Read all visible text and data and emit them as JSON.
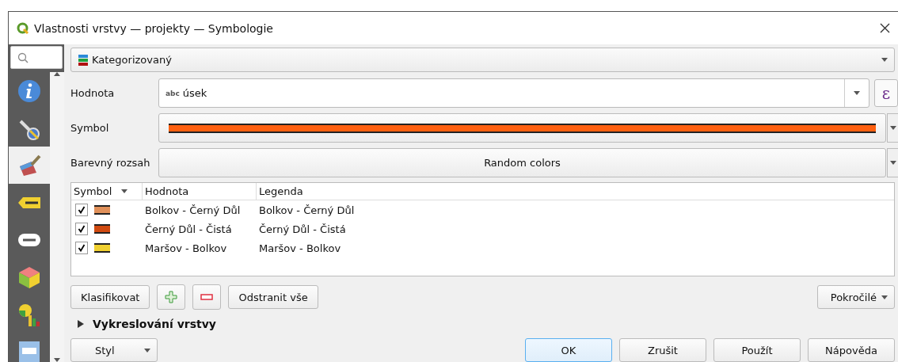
{
  "window": {
    "title": "Vlastnosti vrstvy — projekty — Symbologie"
  },
  "sidebar": {
    "items": [
      {
        "kind": "info",
        "selected": false
      },
      {
        "kind": "tools",
        "selected": false
      },
      {
        "kind": "brush",
        "selected": true
      },
      {
        "kind": "label",
        "selected": false
      },
      {
        "kind": "label2",
        "selected": false
      },
      {
        "kind": "cube",
        "selected": false
      },
      {
        "kind": "diagram",
        "selected": false
      },
      {
        "kind": "form",
        "selected": false
      }
    ]
  },
  "renderer": {
    "value": "Kategorizovaný"
  },
  "fields": [
    {
      "kind": "expression",
      "label": "Hodnota",
      "type_tag": "abc",
      "value": "úsek",
      "button": "ε"
    },
    {
      "kind": "symbol",
      "label": "Symbol",
      "color": "#ff6010"
    },
    {
      "kind": "ramp",
      "label": "Barevný rozsah",
      "value": "Random colors"
    }
  ],
  "table": {
    "columns": [
      "Symbol",
      "Hodnota",
      "Legenda"
    ],
    "rows": [
      {
        "checked": true,
        "color": "#e0905a",
        "value": "Bolkov - Černý Důl",
        "legend": "Bolkov - Černý Důl"
      },
      {
        "checked": true,
        "color": "#d04a10",
        "value": "Černý Důl - Čistá",
        "legend": "Černý Důl - Čistá"
      },
      {
        "checked": true,
        "color": "#f0d030",
        "value": "Maršov - Bolkov",
        "legend": "Maršov - Bolkov"
      }
    ]
  },
  "actions": {
    "classify": "Klasifikovat",
    "remove_all": "Odstranit vše",
    "advanced": "Pokročilé"
  },
  "section": {
    "title": "Vykreslování vrstvy",
    "expanded": false
  },
  "style_button": "Styl",
  "buttons": [
    {
      "label": "OK",
      "selected": true
    },
    {
      "label": "Zrušit",
      "selected": false
    },
    {
      "label": "Použít",
      "selected": false
    },
    {
      "label": "Nápověda",
      "selected": false
    }
  ]
}
